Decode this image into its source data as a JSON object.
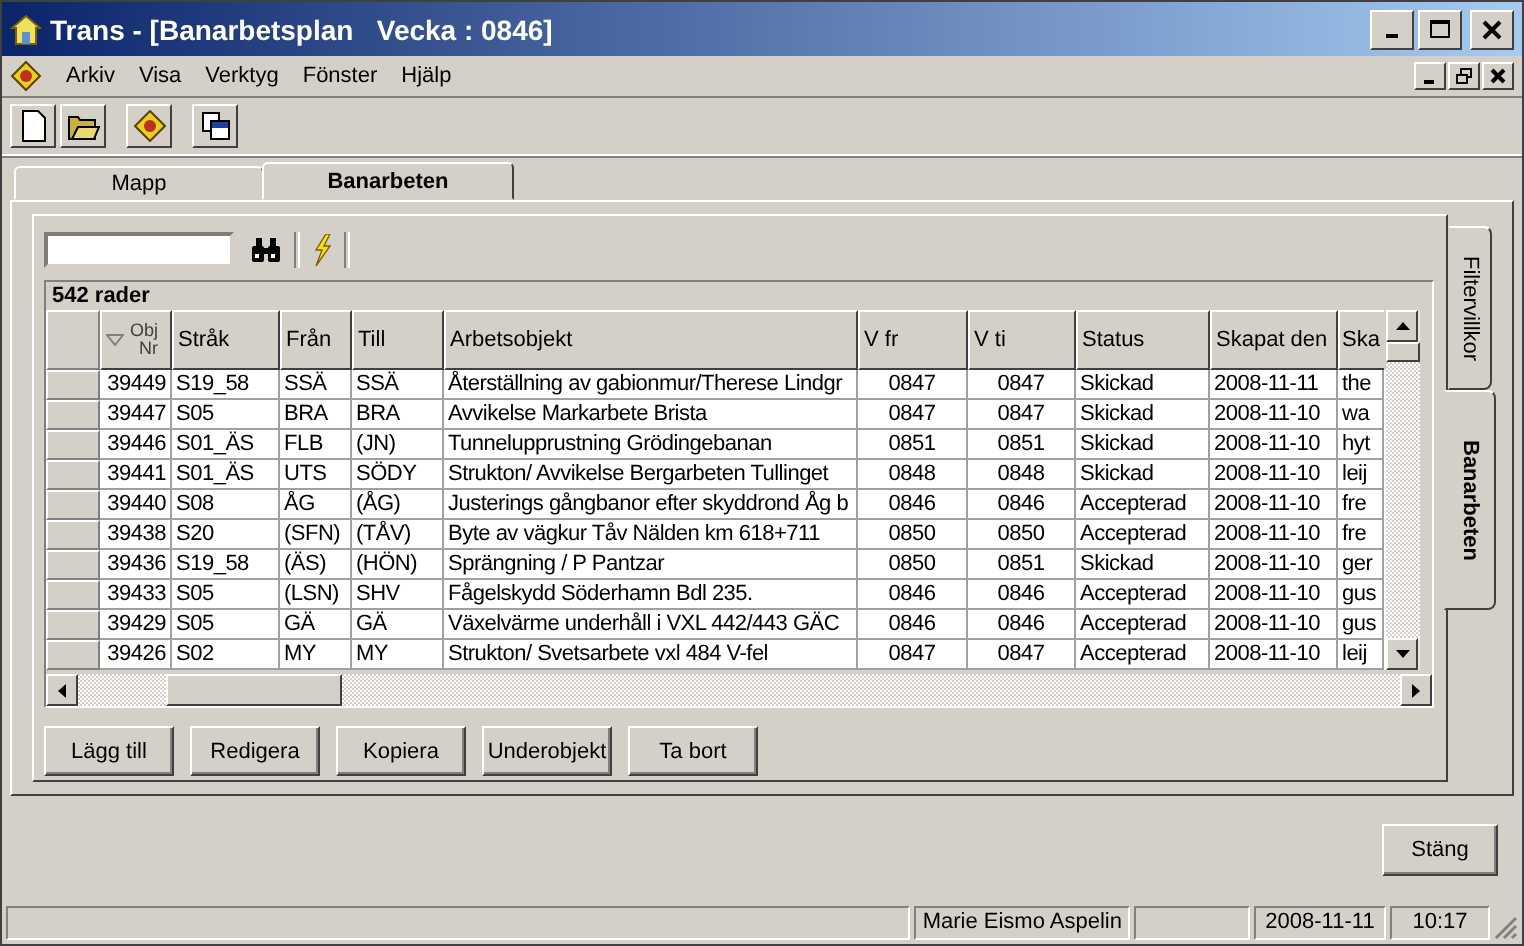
{
  "window": {
    "title": "Trans - [Banarbetsplan   Vecka : 0846]"
  },
  "menu": [
    "Arkiv",
    "Visa",
    "Verktyg",
    "Fönster",
    "Hjälp"
  ],
  "tabs": [
    {
      "label": "Mapp",
      "selected": false
    },
    {
      "label": "Banarbeten",
      "selected": true
    }
  ],
  "side_tabs": [
    {
      "label": "Filtervillkor",
      "selected": false
    },
    {
      "label": "Banarbeten",
      "selected": true
    }
  ],
  "grid": {
    "caption": "542 rader",
    "columns": [
      {
        "label": "Obj Nr",
        "sorted": true
      },
      {
        "label": "Stråk",
        "sorted": false
      },
      {
        "label": "Från",
        "sorted": false
      },
      {
        "label": "Till",
        "sorted": false
      },
      {
        "label": "Arbetsobjekt",
        "sorted": false
      },
      {
        "label": "V fr",
        "sorted": false
      },
      {
        "label": "V ti",
        "sorted": false
      },
      {
        "label": "Status",
        "sorted": false
      },
      {
        "label": "Skapat den",
        "sorted": false
      },
      {
        "label": "Ska",
        "sorted": false
      }
    ],
    "rows": [
      [
        "39449",
        "S19_58",
        "SSÄ",
        "SSÄ",
        "Återställning av gabionmur/Therese Lindgr",
        "0847",
        "0847",
        "Skickad",
        "2008-11-11",
        "the"
      ],
      [
        "39447",
        "S05",
        "BRA",
        "BRA",
        "Avvikelse Markarbete Brista",
        "0847",
        "0847",
        "Skickad",
        "2008-11-10",
        "wa"
      ],
      [
        "39446",
        "S01_ÄS",
        "FLB",
        "(JN)",
        "Tunnelupprustning Grödingebanan",
        "0851",
        "0851",
        "Skickad",
        "2008-11-10",
        "hyt"
      ],
      [
        "39441",
        "S01_ÄS",
        "UTS",
        "SÖDY",
        "Strukton/ Avvikelse Bergarbeten Tullinget",
        "0848",
        "0848",
        "Skickad",
        "2008-11-10",
        "leij"
      ],
      [
        "39440",
        "S08",
        "ÅG",
        "(ÅG)",
        "Justerings gångbanor efter skyddrond Åg b",
        "0846",
        "0846",
        "Accepterad",
        "2008-11-10",
        "fre"
      ],
      [
        "39438",
        "S20",
        "(SFN)",
        "(TÅV)",
        "Byte av vägkur Tåv Nälden km 618+711",
        "0850",
        "0850",
        "Accepterad",
        "2008-11-10",
        "fre"
      ],
      [
        "39436",
        "S19_58",
        "(ÄS)",
        "(HÖN)",
        "Sprängning / P Pantzar",
        "0850",
        "0851",
        "Skickad",
        "2008-11-10",
        "ger"
      ],
      [
        "39433",
        "S05",
        "(LSN)",
        "SHV",
        "Fågelskydd Söderhamn Bdl 235.",
        "0846",
        "0846",
        "Accepterad",
        "2008-11-10",
        "gus"
      ],
      [
        "39429",
        "S05",
        "GÄ",
        "GÄ",
        "Växelvärme underhåll i VXL 442/443 GÄC",
        "0846",
        "0846",
        "Accepterad",
        "2008-11-10",
        "gus"
      ],
      [
        "39426",
        "S02",
        "MY",
        "MY",
        "Strukton/ Svetsarbete vxl 484 V-fel",
        "0847",
        "0847",
        "Accepterad",
        "2008-11-10",
        "leij"
      ]
    ]
  },
  "buttons": [
    "Lägg till",
    "Redigera",
    "Kopiera",
    "Underobjekt",
    "Ta bort"
  ],
  "close_button": "Stäng",
  "status_bar": {
    "user": "Marie Eismo Aspelin",
    "date": "2008-11-11",
    "time": "10:17"
  }
}
